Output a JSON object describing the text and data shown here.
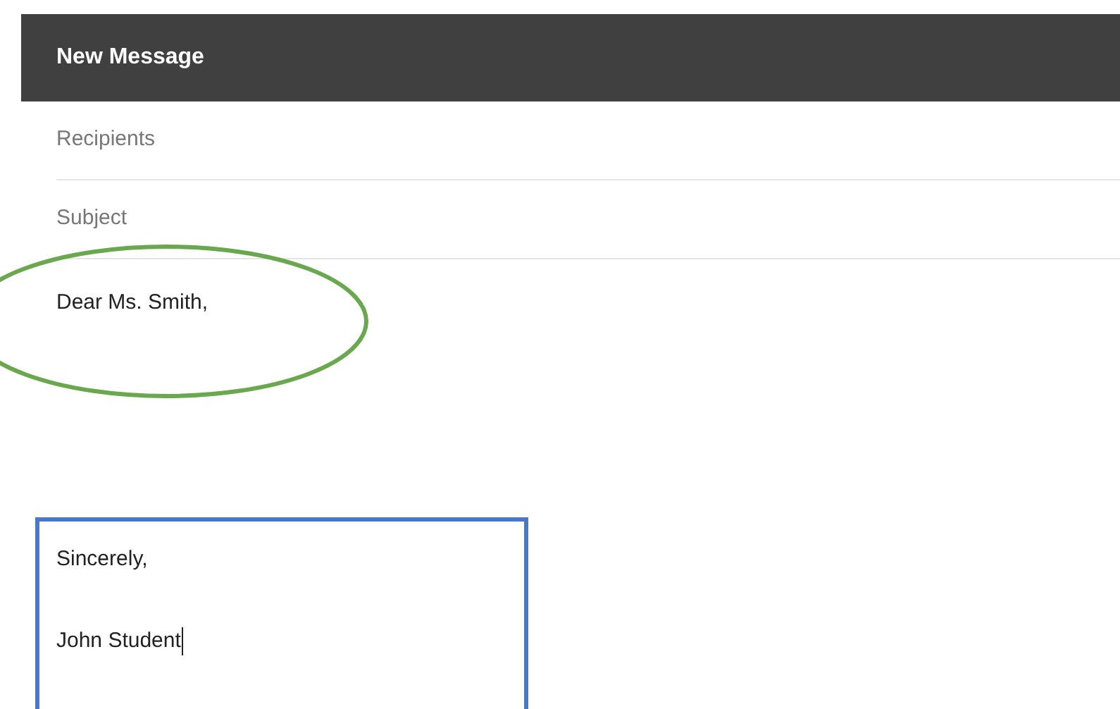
{
  "window": {
    "title": "New Message"
  },
  "fields": [
    {
      "placeholder": "Recipients"
    },
    {
      "placeholder": "Subject"
    }
  ],
  "body": {
    "greeting": "Dear Ms. Smith,",
    "closing": "Sincerely,",
    "signature": "John Student"
  },
  "annotations": [
    {
      "kind": "ellipse",
      "color": "#6aa84f"
    },
    {
      "kind": "rectangle",
      "color": "#4a78c2"
    }
  ]
}
